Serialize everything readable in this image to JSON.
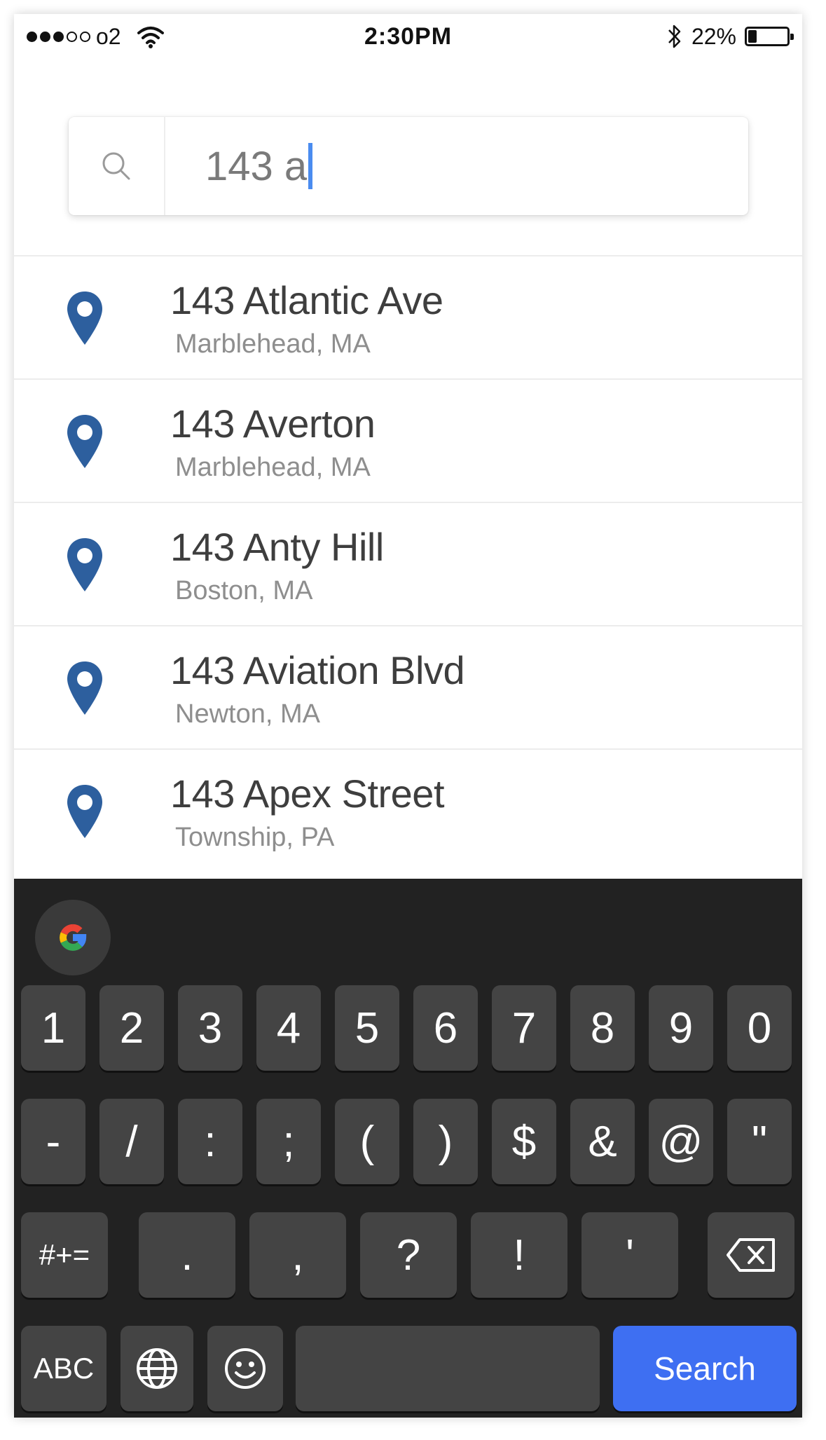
{
  "status_bar": {
    "carrier": "o2",
    "time": "2:30PM",
    "battery_percent": "22%",
    "battery_level": 0.22,
    "signal_filled": 3,
    "signal_total": 5
  },
  "search": {
    "value": "143 a",
    "icon": "search-icon"
  },
  "results": [
    {
      "title": "143 Atlantic Ave",
      "subtitle": "Marblehead, MA",
      "icon": "location-pin-icon"
    },
    {
      "title": "143 Averton",
      "subtitle": "Marblehead, MA",
      "icon": "location-pin-icon"
    },
    {
      "title": "143 Anty Hill",
      "subtitle": "Boston, MA",
      "icon": "location-pin-icon"
    },
    {
      "title": "143 Aviation Blvd",
      "subtitle": "Newton, MA",
      "icon": "location-pin-icon"
    },
    {
      "title": "143 Apex Street",
      "subtitle": "Township, PA",
      "icon": "location-pin-icon"
    }
  ],
  "keyboard": {
    "row1": [
      "1",
      "2",
      "3",
      "4",
      "5",
      "6",
      "7",
      "8",
      "9",
      "0"
    ],
    "row2": [
      "-",
      "/",
      ":",
      ";",
      "(",
      ")",
      "$",
      "&",
      "@",
      "\""
    ],
    "row3": [
      "#+=",
      ".",
      ",",
      "?",
      "!",
      "'"
    ],
    "abc_label": "ABC",
    "search_label": "Search",
    "accent_color": "#3e6ff2",
    "pin_color": "#2d5f9e"
  }
}
